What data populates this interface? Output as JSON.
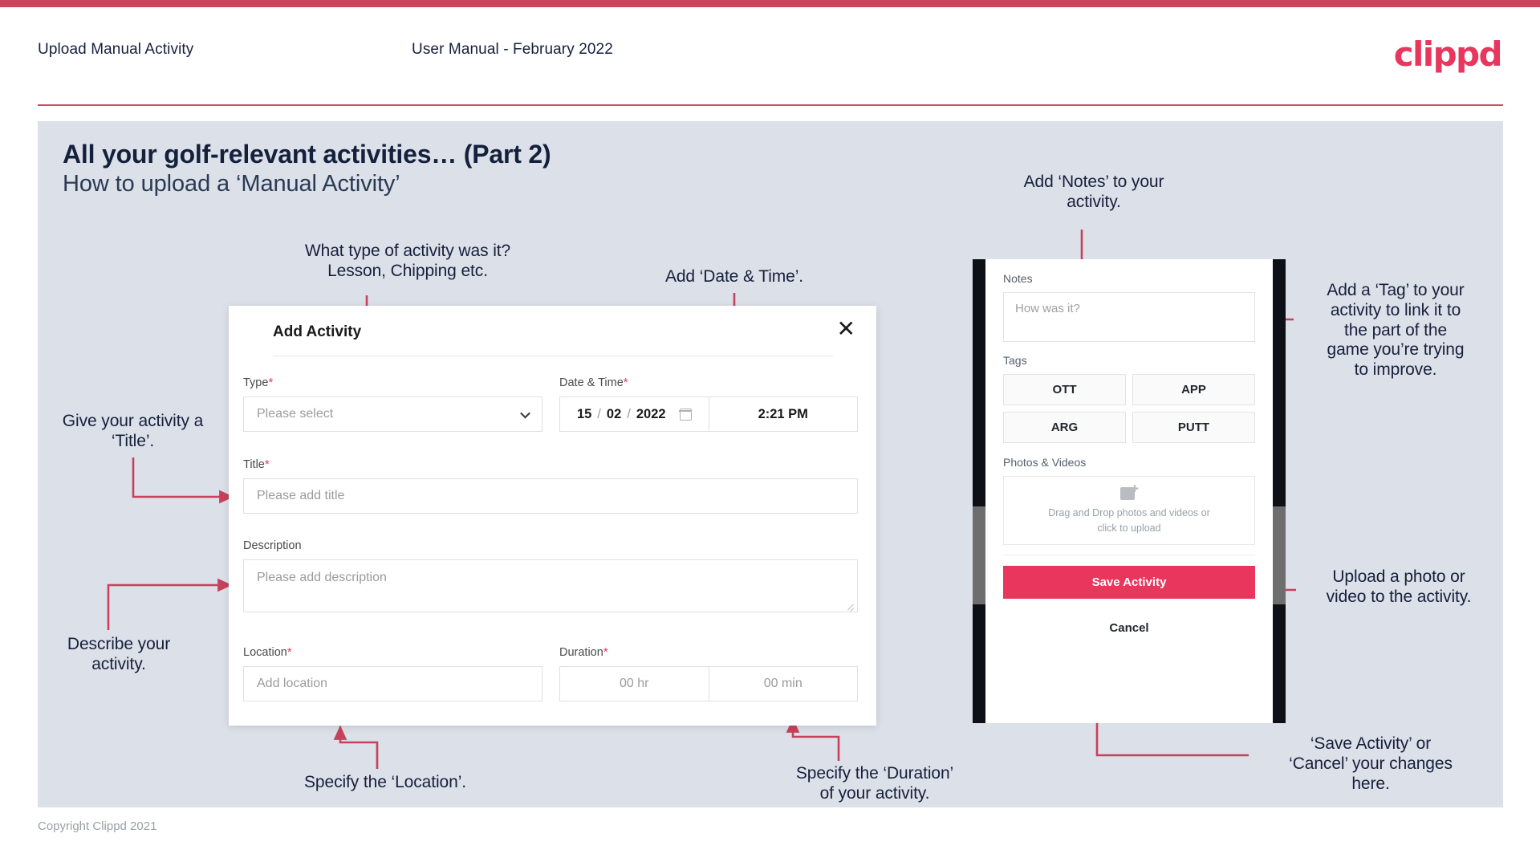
{
  "header": {
    "title": "Upload Manual Activity",
    "subtitle": "User Manual - February 2022",
    "brand": "clippd"
  },
  "slide": {
    "title": "All your golf-relevant activities… (Part 2)",
    "subtitle": "How to upload a ‘Manual Activity’"
  },
  "annotations": {
    "type": "What type of activity was it?\nLesson, Chipping etc.",
    "date_time": "Add ‘Date & Time’.",
    "notes": "Add ‘Notes’ to your\nactivity.",
    "tag": "Add a ‘Tag’ to your\nactivity to link it to\nthe part of the\ngame you’re trying\nto improve.",
    "title_field": "Give your activity a\n‘Title’.",
    "description": "Describe your\nactivity.",
    "location": "Specify the ‘Location’.",
    "duration": "Specify the ‘Duration’\nof your activity.",
    "upload": "Upload a photo or\nvideo to the activity.",
    "save_cancel": "‘Save Activity’ or\n‘Cancel’ your changes\nhere."
  },
  "modal": {
    "title": "Add Activity",
    "close_icon": "✕",
    "fields": {
      "type": {
        "label": "Type",
        "required": "*",
        "placeholder": "Please select"
      },
      "date_time": {
        "label": "Date & Time",
        "required": "*",
        "day": "15",
        "month": "02",
        "year": "2022",
        "sep": "/",
        "time": "2:21 PM"
      },
      "title": {
        "label": "Title",
        "required": "*",
        "placeholder": "Please add title"
      },
      "description": {
        "label": "Description",
        "required": "",
        "placeholder": "Please add description"
      },
      "location": {
        "label": "Location",
        "required": "*",
        "placeholder": "Add location"
      },
      "duration": {
        "label": "Duration",
        "required": "*",
        "hours_placeholder": "00 hr",
        "minutes_placeholder": "00 min"
      }
    }
  },
  "phone": {
    "notes": {
      "label": "Notes",
      "placeholder": "How was it?"
    },
    "tags": {
      "label": "Tags",
      "items": [
        "OTT",
        "APP",
        "ARG",
        "PUTT"
      ]
    },
    "photos": {
      "label": "Photos & Videos",
      "drop_line1": "Drag and Drop photos and videos or",
      "drop_line2": "click to upload"
    },
    "save_label": "Save Activity",
    "cancel_label": "Cancel"
  },
  "footer": {
    "copyright": "Copyright Clippd 2021"
  },
  "colors": {
    "accent": "#e8365d",
    "accent_bar": "#ce445c",
    "slide_bg": "#dce0e8",
    "text_dark": "#15203c",
    "arrow": "#c8415c"
  }
}
